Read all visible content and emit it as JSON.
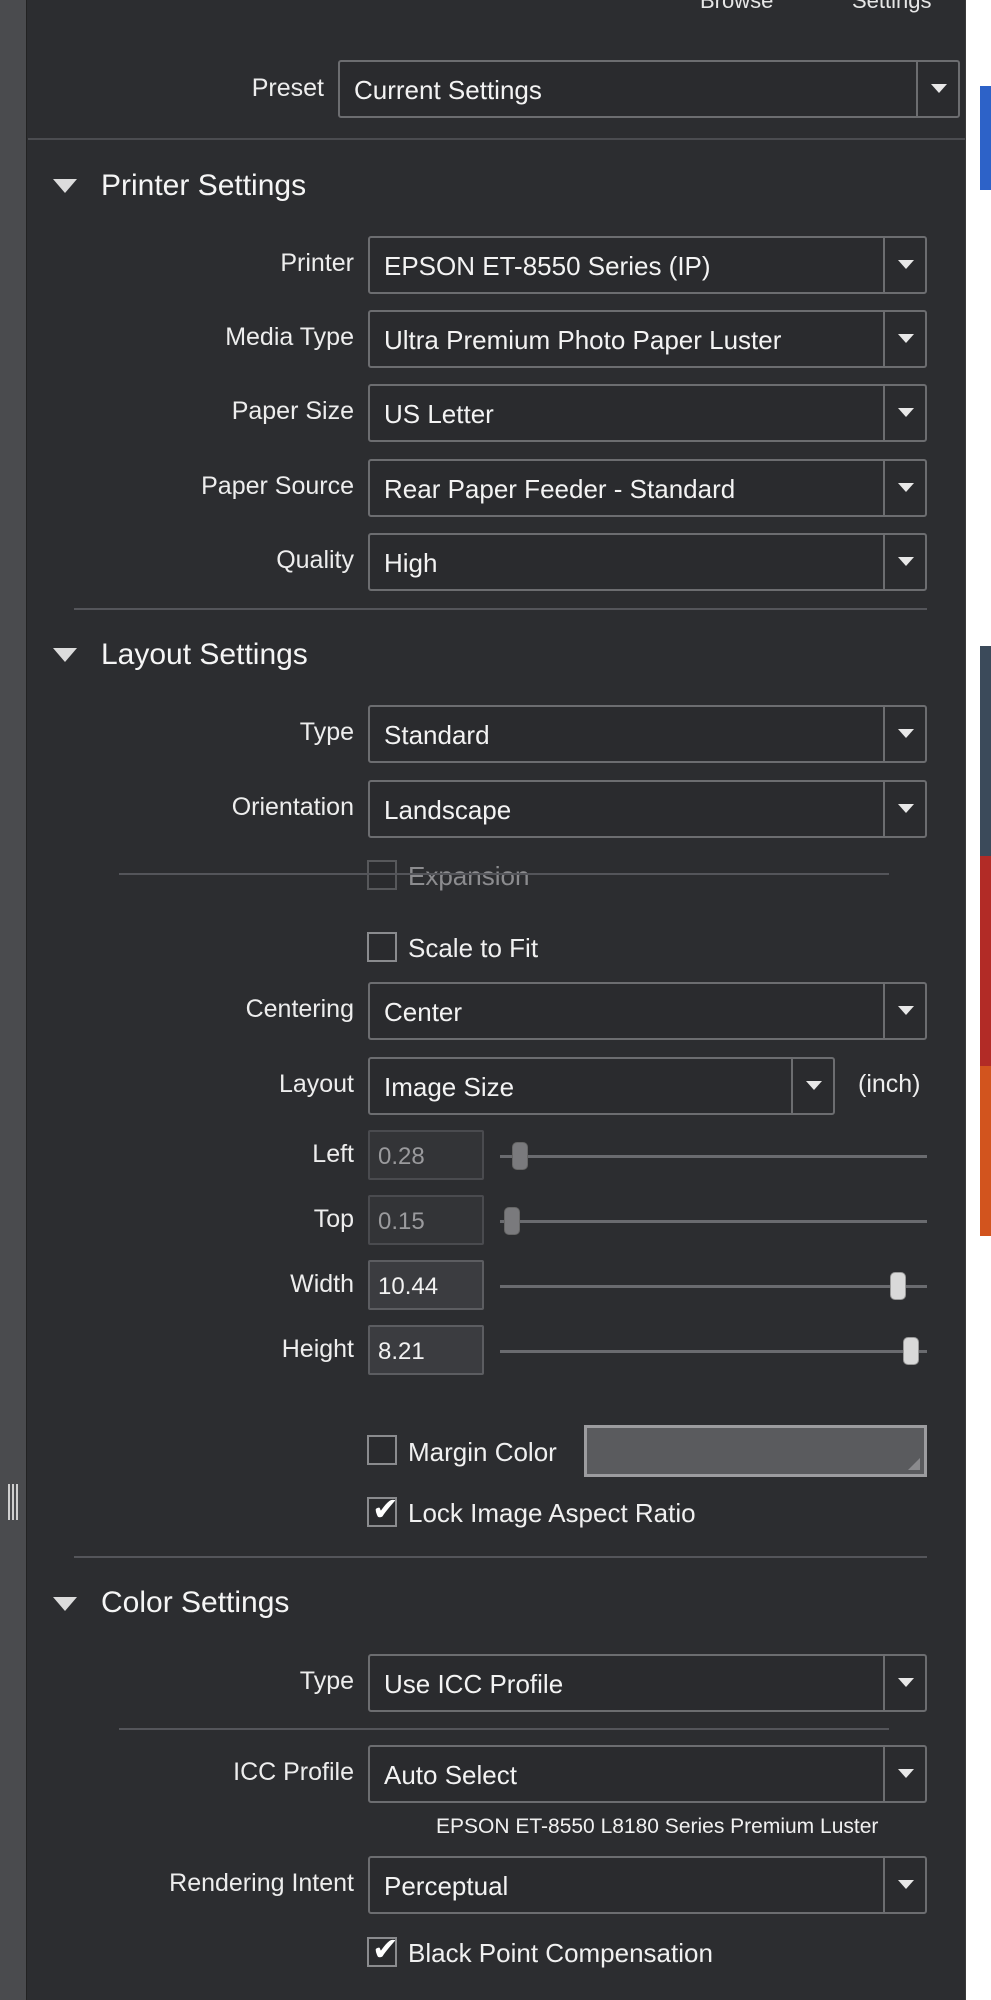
{
  "topbar": {
    "browse_label": "Browse",
    "settings_label": "Settings"
  },
  "preset": {
    "label": "Preset",
    "value": "Current Settings"
  },
  "printer_settings": {
    "title": "Printer Settings",
    "printer": {
      "label": "Printer",
      "value": "EPSON ET-8550 Series (IP)"
    },
    "media_type": {
      "label": "Media Type",
      "value": "Ultra Premium Photo Paper Luster"
    },
    "paper_size": {
      "label": "Paper Size",
      "value": "US Letter"
    },
    "paper_source": {
      "label": "Paper Source",
      "value": "Rear Paper Feeder - Standard"
    },
    "quality": {
      "label": "Quality",
      "value": "High"
    }
  },
  "layout_settings": {
    "title": "Layout Settings",
    "type": {
      "label": "Type",
      "value": "Standard"
    },
    "orientation": {
      "label": "Orientation",
      "value": "Landscape"
    },
    "expansion": {
      "label": "Expansion",
      "checked": false,
      "enabled": false
    },
    "scale_to_fit": {
      "label": "Scale to Fit",
      "checked": false
    },
    "centering": {
      "label": "Centering",
      "value": "Center"
    },
    "layout": {
      "label": "Layout",
      "value": "Image Size",
      "unit": "(inch)"
    },
    "left": {
      "label": "Left",
      "value": "0.28",
      "slider_fraction": 0.03
    },
    "top": {
      "label": "Top",
      "value": "0.15",
      "slider_fraction": 0.01
    },
    "width": {
      "label": "Width",
      "value": "10.44",
      "slider_fraction": 0.95
    },
    "height": {
      "label": "Height",
      "value": "8.21",
      "slider_fraction": 0.98
    },
    "margin_color": {
      "label": "Margin Color",
      "checked": false,
      "color": "#5a5b5e"
    },
    "lock_aspect": {
      "label": "Lock Image Aspect Ratio",
      "checked": true
    }
  },
  "color_settings": {
    "title": "Color Settings",
    "type": {
      "label": "Type",
      "value": "Use ICC Profile"
    },
    "icc_profile": {
      "label": "ICC Profile",
      "value": "Auto Select",
      "note": "EPSON ET-8550 L8180 Series Premium Luster"
    },
    "rendering_intent": {
      "label": "Rendering Intent",
      "value": "Perceptual"
    },
    "black_point": {
      "label": "Black Point Compensation",
      "checked": true
    }
  },
  "colors": {
    "panel_bg": "#2c2d30",
    "field_bg": "#2a2b2e",
    "border": "#6c6d70",
    "text": "#f2f2f2"
  }
}
